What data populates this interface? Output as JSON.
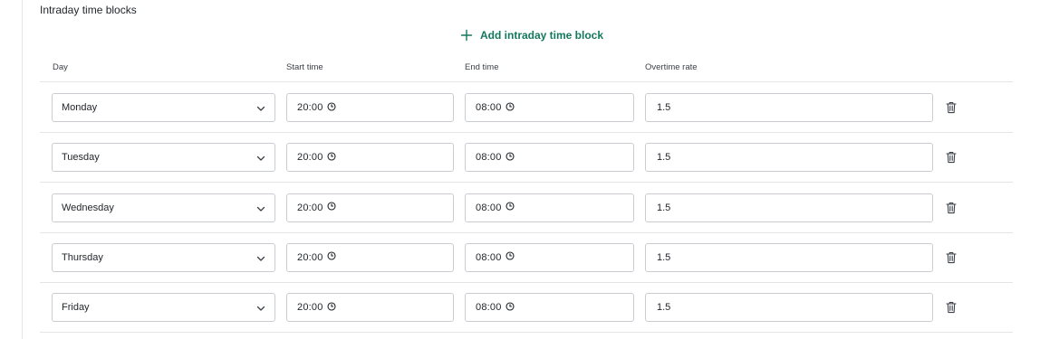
{
  "section": {
    "title": "Intraday time blocks",
    "add_label": "Add intraday time block"
  },
  "columns": {
    "day": "Day",
    "start": "Start time",
    "end": "End time",
    "rate": "Overtime rate"
  },
  "rows": [
    {
      "day": "Monday",
      "start": "20:00",
      "end": "08:00",
      "rate": "1.5"
    },
    {
      "day": "Tuesday",
      "start": "20:00",
      "end": "08:00",
      "rate": "1.5"
    },
    {
      "day": "Wednesday",
      "start": "20:00",
      "end": "08:00",
      "rate": "1.5"
    },
    {
      "day": "Thursday",
      "start": "20:00",
      "end": "08:00",
      "rate": "1.5"
    },
    {
      "day": "Friday",
      "start": "20:00",
      "end": "08:00",
      "rate": "1.5"
    }
  ],
  "icons": {
    "add": "plus-icon",
    "day_select": "chevron-down-icon",
    "time": "clock-icon",
    "delete": "trash-icon"
  },
  "colors": {
    "accent": "#13795b",
    "border": "#c9cdd2",
    "divider": "#e3e5e8"
  }
}
